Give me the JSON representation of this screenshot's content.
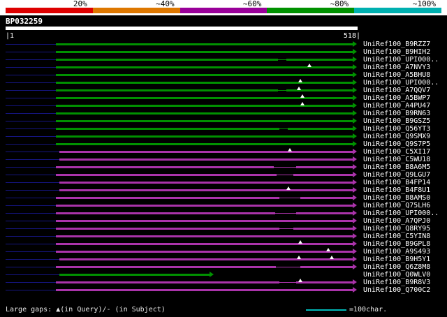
{
  "chart_data": {
    "type": "bar",
    "subtype": "sequence-alignment-overview",
    "query": {
      "name": "BP032259",
      "length": 518,
      "axis_start_label": "|1",
      "axis_end_label": "518|"
    },
    "identity_key": [
      {
        "label": "20%",
        "color": "#dd0000"
      },
      {
        "label": "~40%",
        "color": "#dd7700"
      },
      {
        "label": "~60%",
        "color": "#990099"
      },
      {
        "label": "~80%",
        "color": "#009100"
      },
      {
        "label": "~100%",
        "color": "#00b0b0"
      }
    ],
    "hits": [
      {
        "name": "UniRef100_B9RZZ7",
        "identity_band": "~80%",
        "color": "green",
        "px": [
          80,
          505
        ],
        "query_range": [
          74,
          513
        ]
      },
      {
        "name": "UniRef100_B9HIH2",
        "identity_band": "~80%",
        "color": "green",
        "px": [
          80,
          505
        ],
        "query_range": [
          74,
          513
        ]
      },
      {
        "name": "UniRef100_UPI000..",
        "identity_band": "~80%",
        "color": "green",
        "px": [
          80,
          505
        ],
        "query_range": [
          74,
          513
        ],
        "gaps": [
          [
            398,
            410
          ]
        ]
      },
      {
        "name": "UniRef100_A7NVY3",
        "identity_band": "~80%",
        "color": "green",
        "px": [
          80,
          505
        ],
        "query_range": [
          74,
          513
        ],
        "markers": [
          443
        ]
      },
      {
        "name": "UniRef100_A5BHU8",
        "identity_band": "~80%",
        "color": "green",
        "px": [
          80,
          505
        ],
        "query_range": [
          74,
          513
        ]
      },
      {
        "name": "UniRef100_UPI000..",
        "identity_band": "~80%",
        "color": "green",
        "px": [
          80,
          505
        ],
        "query_range": [
          74,
          513
        ],
        "markers": [
          430
        ]
      },
      {
        "name": "UniRef100_A7QQV7",
        "identity_band": "~80%",
        "color": "green",
        "px": [
          80,
          505
        ],
        "query_range": [
          74,
          513
        ],
        "markers": [
          428
        ],
        "gaps": [
          [
            398,
            410
          ]
        ]
      },
      {
        "name": "UniRef100_A5BWP7",
        "identity_band": "~80%",
        "color": "green",
        "px": [
          80,
          505
        ],
        "query_range": [
          74,
          513
        ],
        "markers": [
          433
        ]
      },
      {
        "name": "UniRef100_A4PU47",
        "identity_band": "~80%",
        "color": "green",
        "px": [
          80,
          505
        ],
        "query_range": [
          74,
          513
        ],
        "markers": [
          433
        ]
      },
      {
        "name": "UniRef100_B9RN63",
        "identity_band": "~80%",
        "color": "green",
        "px": [
          80,
          505
        ],
        "query_range": [
          74,
          513
        ]
      },
      {
        "name": "UniRef100_B9GSZ5",
        "identity_band": "~80%",
        "color": "green",
        "px": [
          80,
          505
        ],
        "query_range": [
          74,
          513
        ]
      },
      {
        "name": "UniRef100_Q56YT3",
        "identity_band": "~80%",
        "color": "green",
        "px": [
          80,
          505
        ],
        "query_range": [
          74,
          513
        ],
        "gaps": [
          [
            400,
            412
          ]
        ]
      },
      {
        "name": "UniRef100_Q9SMX9",
        "identity_band": "~80%",
        "color": "green",
        "px": [
          80,
          505
        ],
        "query_range": [
          74,
          513
        ]
      },
      {
        "name": "UniRef100_Q9S7P5",
        "identity_band": "~80%",
        "color": "green",
        "px": [
          80,
          505
        ],
        "query_range": [
          74,
          513
        ]
      },
      {
        "name": "UniRef100_C5XI17",
        "identity_band": "~60%",
        "color": "magenta",
        "px": [
          85,
          505
        ],
        "query_range": [
          79,
          513
        ],
        "markers": [
          415
        ]
      },
      {
        "name": "UniRef100_C5WU18",
        "identity_band": "~60%",
        "color": "magenta",
        "px": [
          85,
          505
        ],
        "query_range": [
          79,
          513
        ]
      },
      {
        "name": "UniRef100_B8A6M5",
        "identity_band": "~60%",
        "color": "magenta",
        "px": [
          80,
          505
        ],
        "query_range": [
          74,
          513
        ],
        "gaps": [
          [
            392,
            424
          ]
        ]
      },
      {
        "name": "UniRef100_Q9LGU7",
        "identity_band": "~60%",
        "color": "magenta",
        "px": [
          80,
          505
        ],
        "query_range": [
          74,
          513
        ],
        "gaps": [
          [
            396,
            420
          ]
        ]
      },
      {
        "name": "UniRef100_B4FP14",
        "identity_band": "~60%",
        "color": "magenta",
        "px": [
          85,
          505
        ],
        "query_range": [
          79,
          513
        ]
      },
      {
        "name": "UniRef100_B4F8U1",
        "identity_band": "~60%",
        "color": "magenta",
        "px": [
          85,
          505
        ],
        "query_range": [
          79,
          513
        ],
        "markers": [
          413
        ]
      },
      {
        "name": "UniRef100_B8AMS0",
        "identity_band": "~60%",
        "color": "magenta",
        "px": [
          80,
          505
        ],
        "query_range": [
          74,
          513
        ],
        "gaps": [
          [
            400,
            430
          ]
        ]
      },
      {
        "name": "UniRef100_Q75LH6",
        "identity_band": "~60%",
        "color": "magenta",
        "px": [
          80,
          505
        ],
        "query_range": [
          74,
          513
        ]
      },
      {
        "name": "UniRef100_UPI000..",
        "identity_band": "~60%",
        "color": "magenta",
        "px": [
          80,
          505
        ],
        "query_range": [
          74,
          513
        ],
        "gaps": [
          [
            394,
            424
          ]
        ]
      },
      {
        "name": "UniRef100_A7QPJ0",
        "identity_band": "~60%",
        "color": "magenta",
        "px": [
          80,
          505
        ],
        "query_range": [
          74,
          513
        ]
      },
      {
        "name": "UniRef100_Q8RY95",
        "identity_band": "~60%",
        "color": "magenta",
        "px": [
          80,
          505
        ],
        "query_range": [
          74,
          513
        ],
        "gaps": [
          [
            400,
            420
          ]
        ]
      },
      {
        "name": "UniRef100_C5YIN8",
        "identity_band": "~60%",
        "color": "magenta",
        "px": [
          80,
          505
        ],
        "query_range": [
          74,
          513
        ]
      },
      {
        "name": "UniRef100_B9GPL8",
        "identity_band": "~60%",
        "color": "magenta",
        "px": [
          80,
          505
        ],
        "query_range": [
          74,
          513
        ],
        "markers": [
          430
        ]
      },
      {
        "name": "UniRef100_A9S493",
        "identity_band": "~60%",
        "color": "magenta",
        "px": [
          80,
          505
        ],
        "query_range": [
          74,
          513
        ],
        "markers": [
          470
        ]
      },
      {
        "name": "UniRef100_B9H5Y1",
        "identity_band": "~60%",
        "color": "magenta",
        "px": [
          85,
          505
        ],
        "query_range": [
          79,
          513
        ],
        "markers": [
          428,
          475
        ]
      },
      {
        "name": "UniRef100_Q6Z8M8",
        "identity_band": "~60%",
        "color": "magenta",
        "px": [
          80,
          505
        ],
        "query_range": [
          74,
          513
        ],
        "gaps": [
          [
            395,
            430
          ]
        ]
      },
      {
        "name": "UniRef100_Q0WLV0",
        "identity_band": "~80%",
        "color": "green",
        "px": [
          85,
          300
        ],
        "query_range": [
          79,
          301
        ]
      },
      {
        "name": "UniRef100_B9R8V3",
        "identity_band": "~60%",
        "color": "magenta",
        "px": [
          80,
          505
        ],
        "query_range": [
          74,
          513
        ],
        "markers": [
          430
        ],
        "gaps": [
          [
            400,
            424
          ]
        ]
      },
      {
        "name": "UniRef100_Q700C2",
        "identity_band": "~60%",
        "color": "magenta",
        "px": [
          80,
          505
        ],
        "query_range": [
          74,
          513
        ]
      }
    ]
  },
  "colors": {
    "green": "#009100",
    "magenta": "#aa33aa",
    "leader": "#151580",
    "query_bar": "#ffffff",
    "scale_line": "#00b8b8"
  },
  "legend": {
    "large_gaps": "Large gaps: ▲(in Query)/- (in Subject)",
    "scale_label": "=100char."
  }
}
